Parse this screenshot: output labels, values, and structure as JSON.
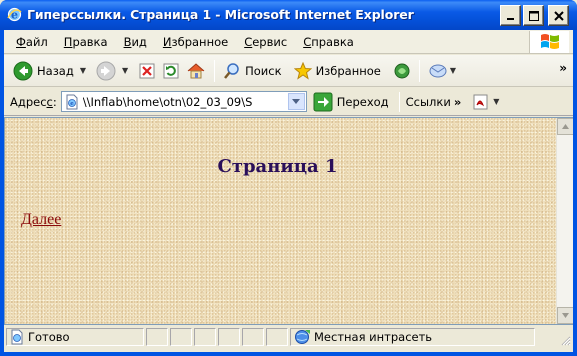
{
  "window": {
    "title": "Гиперссылки. Страница 1 - Microsoft Internet Explorer",
    "minimize_label": "",
    "close_label": ""
  },
  "menu": {
    "items": [
      {
        "u": "Ф",
        "rest": "айл"
      },
      {
        "u": "П",
        "rest": "равка"
      },
      {
        "u": "В",
        "rest": "ид"
      },
      {
        "u": "И",
        "rest": "збранное"
      },
      {
        "u": "С",
        "rest": "ервис"
      },
      {
        "u": "С",
        "rest": "правка"
      }
    ]
  },
  "toolbar": {
    "back_label": "Назад",
    "search_label": "Поиск",
    "favorites_label": "Избранное",
    "more": "»"
  },
  "address": {
    "label_prefix": "Адрес",
    "label_u": "с",
    "label_suffix": ":",
    "value": "\\\\Inflab\\home\\otn\\02_03_09\\S",
    "go_label": "Переход",
    "links_label": "Ссылки",
    "more": "»"
  },
  "page": {
    "heading": "Страница 1",
    "link_text": "Далее"
  },
  "status": {
    "text": "Готово",
    "zone": "Местная интрасеть"
  },
  "colors": {
    "titlebar": "#0A5AE6",
    "heading": "#2A0F5A",
    "link": "#8B0A0A",
    "page_bg": "#EEDDB8"
  }
}
